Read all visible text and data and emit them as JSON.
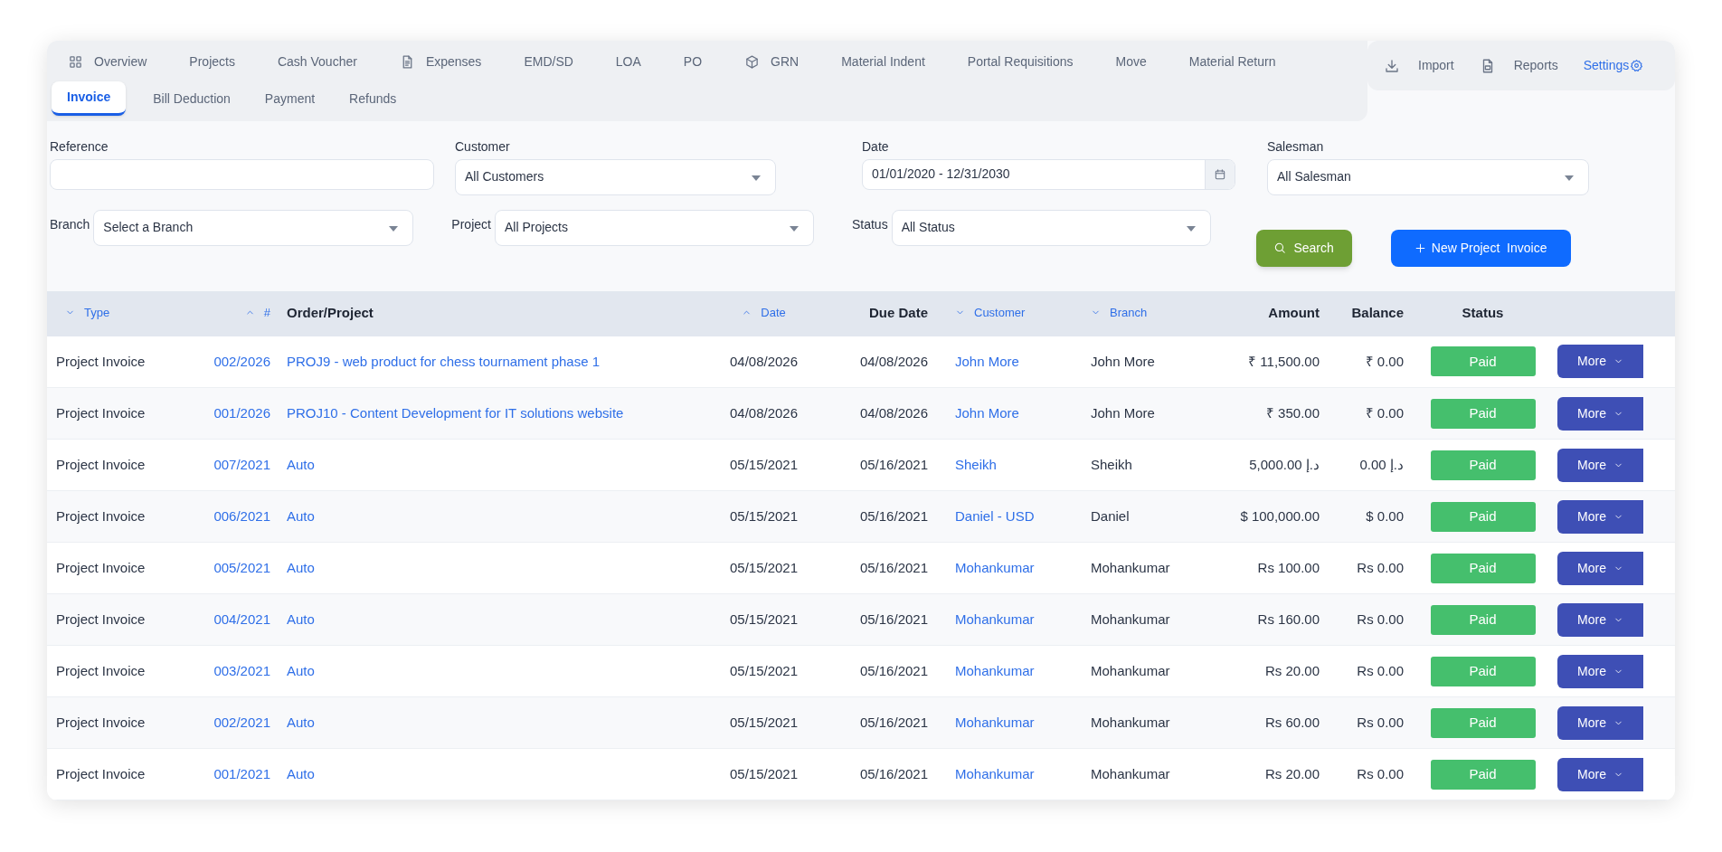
{
  "tab_rows": [
    {
      "tabs": [
        {
          "label": "Overview",
          "selected": false
        },
        {
          "label": "Projects",
          "selected": false
        },
        {
          "label": "Cash Voucher",
          "selected": false
        },
        {
          "label": "Expenses",
          "selected": false
        },
        {
          "label": "EMD/SD",
          "selected": false
        },
        {
          "label": "LOA",
          "selected": false
        },
        {
          "label": "PO",
          "selected": false
        },
        {
          "label": "GRN",
          "selected": false
        },
        {
          "label": "Material Indent",
          "selected": false
        },
        {
          "label": "Portal Requisitions",
          "selected": false
        },
        {
          "label": "Move",
          "selected": false
        },
        {
          "label": "Material Return",
          "selected": false
        }
      ]
    },
    {
      "tabs": [
        {
          "label": "Invoice",
          "selected": true
        },
        {
          "label": "Bill Deduction",
          "selected": false
        },
        {
          "label": "Payment",
          "selected": false
        },
        {
          "label": "Refunds",
          "selected": false
        }
      ]
    }
  ],
  "actions": [
    {
      "label": "Import",
      "kind": "import"
    },
    {
      "label": "Reports",
      "kind": "reports"
    },
    {
      "label": "Settings",
      "kind": "settings"
    }
  ],
  "filter_rows": [
    {
      "filters": [
        {
          "kind": "text",
          "label": "Reference"
        },
        {
          "kind": "select",
          "label": "Customer",
          "value": "All Customers"
        },
        {
          "kind": "date",
          "label": "Date",
          "value": "01/01/2020 - 12/31/2030"
        },
        {
          "kind": "select",
          "label": "Salesman",
          "value": "All Salesman"
        }
      ]
    },
    {
      "filters": [
        {
          "kind": "select",
          "label": "Branch",
          "value": "Select a Branch"
        },
        {
          "kind": "select",
          "label": "Project",
          "value": "All Projects"
        },
        {
          "kind": "select",
          "label": "Status",
          "value": "All Status"
        }
      ]
    }
  ],
  "buttons": [
    {
      "label": "Search",
      "kind": "search"
    },
    {
      "label": "New Project  Invoice",
      "kind": "new"
    }
  ],
  "table": {
    "columns": [
      {
        "label": "Type",
        "sortable": true,
        "ascending": false
      },
      {
        "label": "#",
        "sortable": true,
        "ascending": true
      },
      {
        "label": "Order/Project",
        "sortable": false
      },
      {
        "label": "Date",
        "sortable": true,
        "ascending": true
      },
      {
        "label": "Due Date",
        "sortable": false
      },
      {
        "label": "Customer",
        "sortable": true,
        "ascending": false
      },
      {
        "label": "Branch",
        "sortable": true,
        "ascending": false
      },
      {
        "label": "Amount",
        "sortable": false
      },
      {
        "label": "Balance",
        "sortable": false
      },
      {
        "label": "Status",
        "sortable": false
      }
    ],
    "rows": [
      {
        "type": "Project Invoice",
        "number": "002/2026",
        "project": "PROJ9 - web product for chess tournament phase 1",
        "date": "04/08/2026",
        "due_date": "04/08/2026",
        "customer": "John More",
        "branch": "John More",
        "amount": "₹ 11,500.00",
        "balance": "₹ 0.00",
        "status": "Paid",
        "action": "More"
      },
      {
        "type": "Project Invoice",
        "number": "001/2026",
        "project": "PROJ10 - Content Development for IT solutions website",
        "date": "04/08/2026",
        "due_date": "04/08/2026",
        "customer": "John More",
        "branch": "John More",
        "amount": "₹ 350.00",
        "balance": "₹ 0.00",
        "status": "Paid",
        "action": "More"
      },
      {
        "type": "Project Invoice",
        "number": "007/2021",
        "project": "Auto",
        "date": "05/15/2021",
        "due_date": "05/16/2021",
        "customer": "Sheikh",
        "branch": "Sheikh",
        "amount": "د.إ 5,000.00",
        "balance": "د.إ 0.00",
        "status": "Paid",
        "action": "More"
      },
      {
        "type": "Project Invoice",
        "number": "006/2021",
        "project": "Auto",
        "date": "05/15/2021",
        "due_date": "05/16/2021",
        "customer": "Daniel - USD",
        "branch": "Daniel",
        "amount": "$ 100,000.00",
        "balance": "$ 0.00",
        "status": "Paid",
        "action": "More"
      },
      {
        "type": "Project Invoice",
        "number": "005/2021",
        "project": "Auto",
        "date": "05/15/2021",
        "due_date": "05/16/2021",
        "customer": "Mohankumar",
        "branch": "Mohankumar",
        "amount": "Rs 100.00",
        "balance": "Rs 0.00",
        "status": "Paid",
        "action": "More"
      },
      {
        "type": "Project Invoice",
        "number": "004/2021",
        "project": "Auto",
        "date": "05/15/2021",
        "due_date": "05/16/2021",
        "customer": "Mohankumar",
        "branch": "Mohankumar",
        "amount": "Rs 160.00",
        "balance": "Rs 0.00",
        "status": "Paid",
        "action": "More"
      },
      {
        "type": "Project Invoice",
        "number": "003/2021",
        "project": "Auto",
        "date": "05/15/2021",
        "due_date": "05/16/2021",
        "customer": "Mohankumar",
        "branch": "Mohankumar",
        "amount": "Rs 20.00",
        "balance": "Rs 0.00",
        "status": "Paid",
        "action": "More"
      },
      {
        "type": "Project Invoice",
        "number": "002/2021",
        "project": "Auto",
        "date": "05/15/2021",
        "due_date": "05/16/2021",
        "customer": "Mohankumar",
        "branch": "Mohankumar",
        "amount": "Rs 60.00",
        "balance": "Rs 0.00",
        "status": "Paid",
        "action": "More"
      },
      {
        "type": "Project Invoice",
        "number": "001/2021",
        "project": "Auto",
        "date": "05/15/2021",
        "due_date": "05/16/2021",
        "customer": "Mohankumar",
        "branch": "Mohankumar",
        "amount": "Rs 20.00",
        "balance": "Rs 0.00",
        "status": "Paid",
        "action": "More"
      }
    ]
  }
}
